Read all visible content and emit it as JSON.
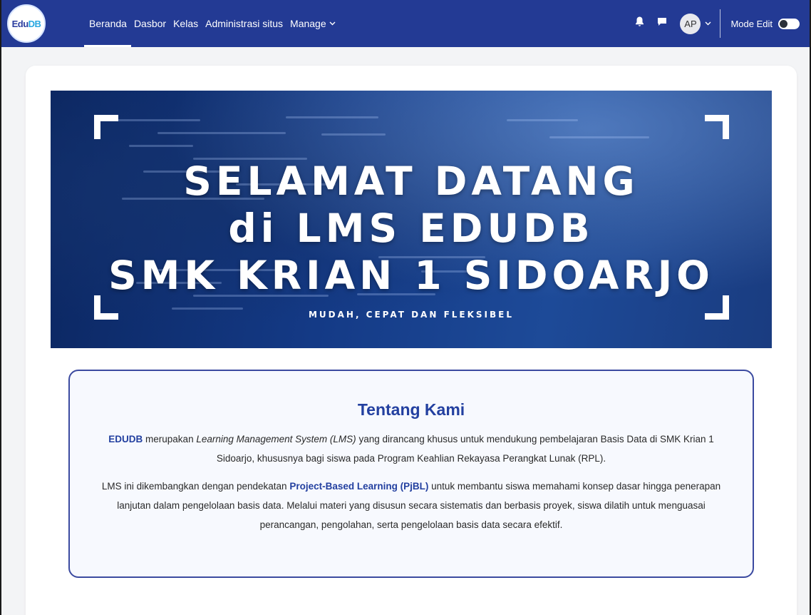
{
  "navbar": {
    "logo_text_a": "Edu",
    "logo_text_b": "DB",
    "links": [
      "Beranda",
      "Dasbor",
      "Kelas",
      "Administrasi situs",
      "Manage"
    ],
    "avatar_initials": "AP",
    "mode_edit_label": "Mode Edit",
    "mode_edit_on": false,
    "bg_color": "#233a94"
  },
  "banner": {
    "line1": "SELAMAT DATANG",
    "line2": "di LMS EDUDB",
    "line3": "SMK KRIAN 1 SIDOARJO",
    "tagline": "MUDAH, CEPAT DAN FLEKSIBEL"
  },
  "about": {
    "title": "Tentang Kami",
    "p1_strong": "EDUDB",
    "p1_a": " merupakan ",
    "p1_em": "Learning Management System (LMS)",
    "p1_b": " yang dirancang khusus untuk mendukung pembelajaran Basis Data di SMK Krian 1 Sidoarjo, khususnya bagi siswa pada Program Keahlian Rekayasa Perangkat Lunak (RPL).",
    "p2_a": "LMS ini dikembangkan dengan pendekatan ",
    "p2_strong": "Project-Based Learning (PjBL)",
    "p2_b": " untuk membantu siswa memahami konsep dasar hingga penerapan lanjutan dalam pengelolaan basis data. Melalui materi yang disusun secara sistematis dan berbasis proyek, siswa dilatih untuk menguasai perancangan, pengolahan, serta pengelolaan basis data secara efektif.",
    "accent_color": "#2340a0"
  },
  "icons": {
    "notification": "bell-icon",
    "messages": "chat-icon",
    "dropdown": "chevron-down-icon"
  }
}
